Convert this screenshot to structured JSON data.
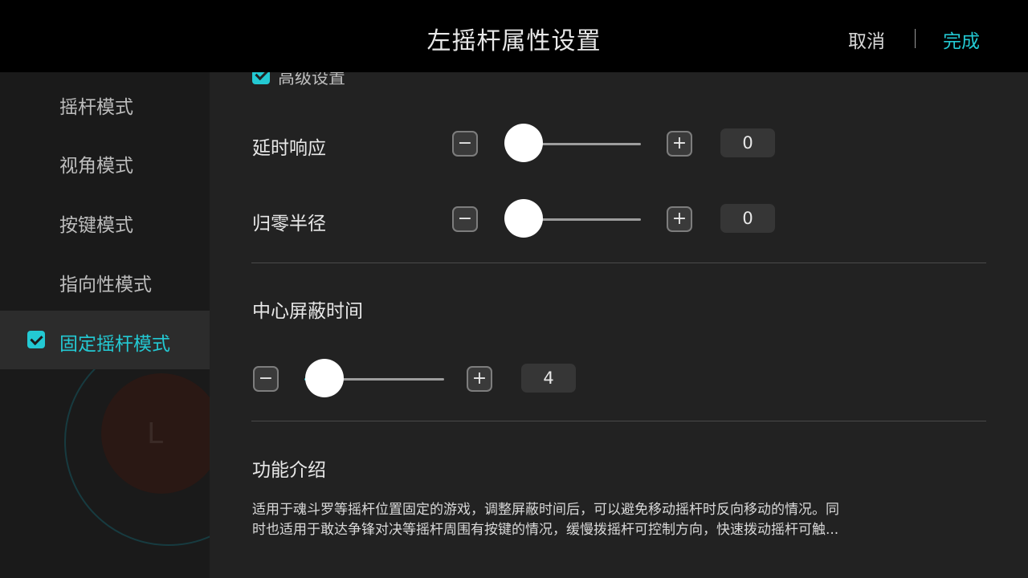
{
  "header": {
    "title": "左摇杆属性设置",
    "cancel_label": "取消",
    "done_label": "完成"
  },
  "sidebar": {
    "background_letter": "L",
    "items": [
      {
        "label": "摇杆模式",
        "active": false
      },
      {
        "label": "视角模式",
        "active": false
      },
      {
        "label": "按键模式",
        "active": false
      },
      {
        "label": "指向性模式",
        "active": false
      },
      {
        "label": "固定摇杆模式",
        "active": true
      }
    ]
  },
  "main": {
    "advanced_label": "高级设置",
    "delay": {
      "label": "延时响应",
      "value": "0"
    },
    "reset_radius": {
      "label": "归零半径",
      "value": "0"
    },
    "center_shield": {
      "title": "中心屏蔽时间",
      "value": "4"
    },
    "minus_symbol": "−",
    "plus_symbol": "+",
    "intro": {
      "title": "功能介绍",
      "line1": "适用于魂斗罗等摇杆位置固定的游戏，调整屏蔽时间后，可以避免移动摇杆时反向移动的情况。同",
      "line2": "时也适用于敢达争锋对决等摇杆周围有按键的情况，缓慢拨摇杆可控制方向，快速拨动摇杆可触..."
    }
  },
  "colors": {
    "accent": "#23c9d3",
    "header_bg": "#000000",
    "sidebar_bg": "#1a1a1a",
    "sidebar_active_bg": "#2c2c2c",
    "main_bg": "#222222"
  }
}
